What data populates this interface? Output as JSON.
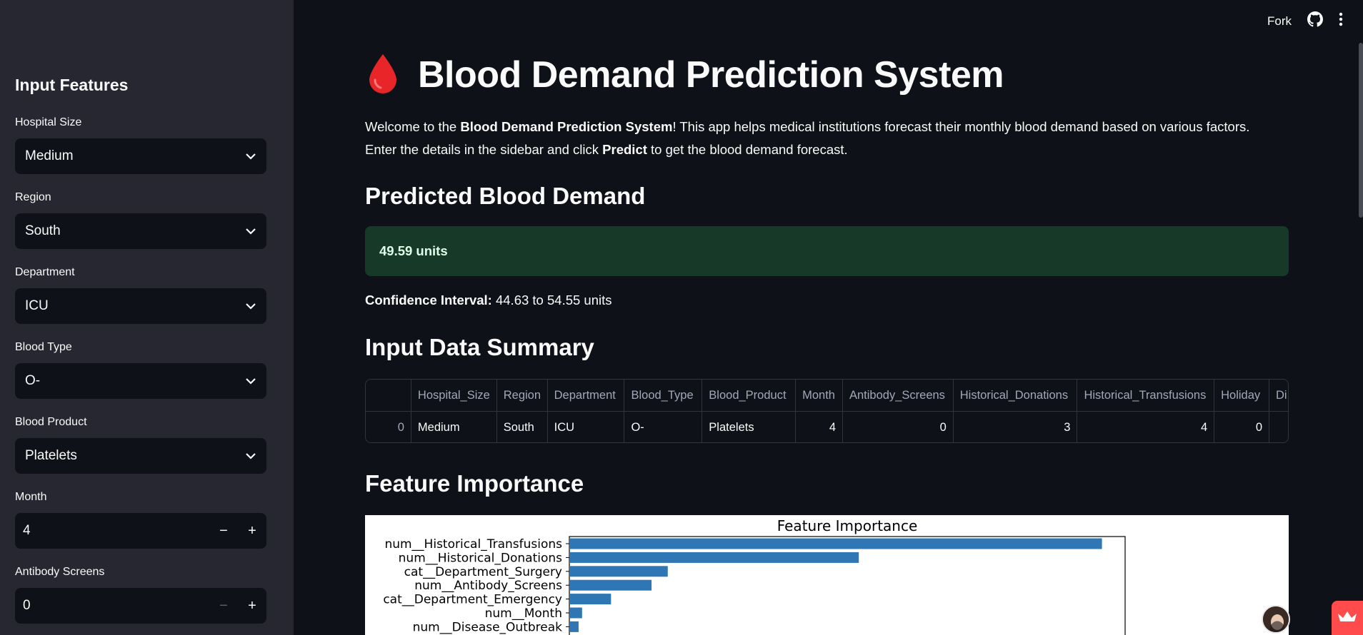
{
  "sidebar": {
    "title": "Input Features",
    "fields": [
      {
        "label": "Hospital Size",
        "value": "Medium"
      },
      {
        "label": "Region",
        "value": "South"
      },
      {
        "label": "Department",
        "value": "ICU"
      },
      {
        "label": "Blood Type",
        "value": "O-"
      },
      {
        "label": "Blood Product",
        "value": "Platelets"
      }
    ],
    "numbers": [
      {
        "label": "Month",
        "value": "4",
        "minus": "−",
        "plus": "+"
      },
      {
        "label": "Antibody Screens",
        "value": "0",
        "minus": "−",
        "plus": "+"
      }
    ]
  },
  "toolbar": {
    "fork_label": "Fork"
  },
  "header": {
    "emoji": "🩸",
    "title": "Blood Demand Prediction System"
  },
  "welcome": {
    "p1_a": "Welcome to the ",
    "p1_b": "Blood Demand Prediction System",
    "p1_c": "! This app helps medical institutions forecast their monthly blood demand based on various factors.",
    "p2_a": "Enter the details in the sidebar and click ",
    "p2_b": "Predict",
    "p2_c": " to get the blood demand forecast."
  },
  "prediction": {
    "heading": "Predicted Blood Demand",
    "value": "49.59 units",
    "ci_label": "Confidence Interval:",
    "ci_value": " 44.63 to 54.55 units"
  },
  "summary": {
    "heading": "Input Data Summary",
    "columns": [
      "",
      "Hospital_Size",
      "Region",
      "Department",
      "Blood_Type",
      "Blood_Product",
      "Month",
      "Antibody_Screens",
      "Historical_Donations",
      "Historical_Transfusions",
      "Holiday",
      "Di"
    ],
    "row": [
      "0",
      "Medium",
      "South",
      "ICU",
      "O-",
      "Platelets",
      "4",
      "0",
      "3",
      "4",
      "0",
      ""
    ]
  },
  "importance": {
    "heading": "Feature Importance"
  },
  "chart_data": {
    "type": "bar",
    "orientation": "horizontal",
    "title": "Feature Importance",
    "categories": [
      "num__Historical_Transfusions",
      "num__Historical_Donations",
      "cat__Department_Surgery",
      "num__Antibody_Screens",
      "cat__Department_Emergency",
      "num__Month",
      "num__Disease_Outbreak"
    ],
    "values": [
      0.46,
      0.25,
      0.085,
      0.071,
      0.036,
      0.011,
      0.008
    ],
    "xlim": [
      0,
      0.48
    ],
    "color": "#2f77b4",
    "grid": false
  },
  "colors": {
    "sidebar_bg": "#262730",
    "main_bg": "#0e1117",
    "success_bg": "#173928",
    "accent": "#ff4b4b"
  }
}
